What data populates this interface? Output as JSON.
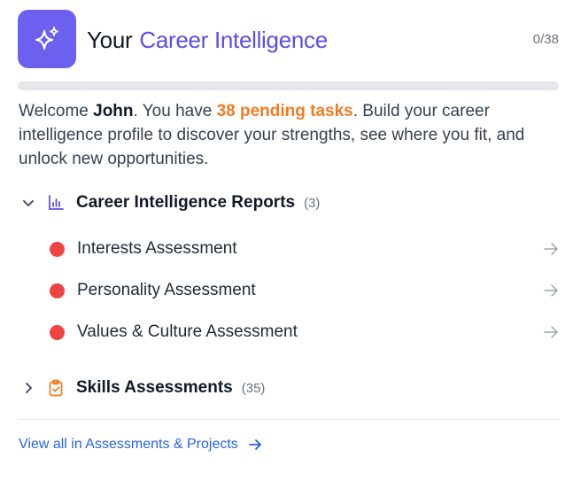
{
  "header": {
    "title_prefix": "Your",
    "title_highlight": "Career Intelligence",
    "progress_text": "0/38",
    "progress_fraction": 0,
    "accent_color": "#6d5ff0",
    "logo_icon": "sparkles-icon"
  },
  "welcome": {
    "part1": "Welcome ",
    "name": "John",
    "part2": ". You have ",
    "pending": "38 pending tasks",
    "part3": ". Build your career intelligence profile to discover your strengths, see where you fit, and unlock new opportunities."
  },
  "sections": [
    {
      "label": "Career Intelligence Reports",
      "count": "(3)",
      "expanded": true,
      "icon": "bar-chart-icon",
      "items": [
        {
          "label": "Interests Assessment",
          "status_color": "#ef4444"
        },
        {
          "label": "Personality Assessment",
          "status_color": "#ef4444"
        },
        {
          "label": "Values & Culture Assessment",
          "status_color": "#ef4444"
        }
      ]
    },
    {
      "label": "Skills Assessments",
      "count": "(35)",
      "expanded": false,
      "icon": "clipboard-check-icon",
      "icon_color": "#f27b1f"
    }
  ],
  "footer": {
    "link_label": "View all in Assessments & Projects",
    "link_color": "#2563eb"
  }
}
